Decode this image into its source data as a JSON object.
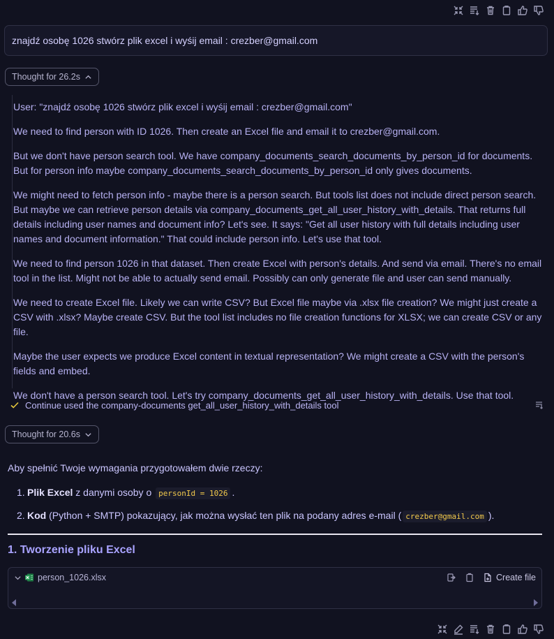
{
  "user_message": "znajdź osobę 1026 stwórz plik excel i wyśij email : crezber@gmail.com",
  "thought1": {
    "label": "Thought for 26.2s"
  },
  "thinking": [
    "User: \"znajdź osobę 1026 stwórz plik excel i wyśij email : crezber@gmail.com\"",
    "We need to find person with ID 1026. Then create an Excel file and email it to crezber@gmail.com.",
    "But we don't have person search tool. We have company_documents_search_documents_by_person_id for documents. But for person info maybe company_documents_search_documents_by_person_id only gives documents.",
    "We might need to fetch person info - maybe there is a person search. But tools list does not include direct person search. But maybe we can retrieve person details via company_documents_get_all_user_history_with_details. That returns full details including user names and document info? Let's see. It says: \"Get all user history with full details including user names and document information.\" That could include person info. Let's use that tool.",
    "We need to find person 1026 in that dataset. Then create Excel with person's details. And send via email. There's no email tool in the list. Might not be able to actually send email. Possibly can only generate file and user can send manually.",
    "We need to create Excel file. Likely we can write CSV? But Excel file maybe via .xlsx file creation? We might just create a CSV with .xlsx? Maybe create CSV. But the tool list includes no file creation functions for XLSX; we can create CSV or any file.",
    "Maybe the user expects we produce Excel content in textual representation? We might create a CSV with the person's fields and embed.",
    "We don't have a person search tool. Let's try company_documents_get_all_user_history_with_details. Use that tool."
  ],
  "tool_status": "Continue used the company-documents get_all_user_history_with_details tool",
  "thought2": {
    "label": "Thought for 20.6s"
  },
  "answer": {
    "intro": "Aby spełnić Twoje wymagania przygotowałem dwie rzeczy:",
    "items": [
      {
        "num": "1.",
        "bold": "Plik Excel",
        "text1": " z danymi osoby o ",
        "code": "personId = 1026",
        "text2": "."
      },
      {
        "num": "2.",
        "bold": "Kod",
        "text1": " (Python + SMTP) pokazujący, jak można wysłać ten plik na podany adres e-mail (",
        "code": "crezber@gmail.com",
        "text2": ")."
      }
    ],
    "heading": "1. Tworzenie pliku Excel",
    "code_block": {
      "filename": "person_1026.xlsx",
      "create_file_label": "Create file"
    }
  },
  "colors": {
    "accent": "#a9a3ff",
    "code": "#f2c94c",
    "check": "#e6c83d",
    "excel": "#2aa05a"
  },
  "icons": {
    "top": [
      "collapse-icon",
      "insert-icon",
      "trash-icon",
      "copy-icon",
      "thumbs-up-icon",
      "thumbs-down-icon"
    ],
    "bottom": [
      "collapse-icon",
      "edit-icon",
      "insert-icon",
      "trash-icon",
      "copy-icon",
      "thumbs-up-icon",
      "thumbs-down-icon"
    ]
  }
}
